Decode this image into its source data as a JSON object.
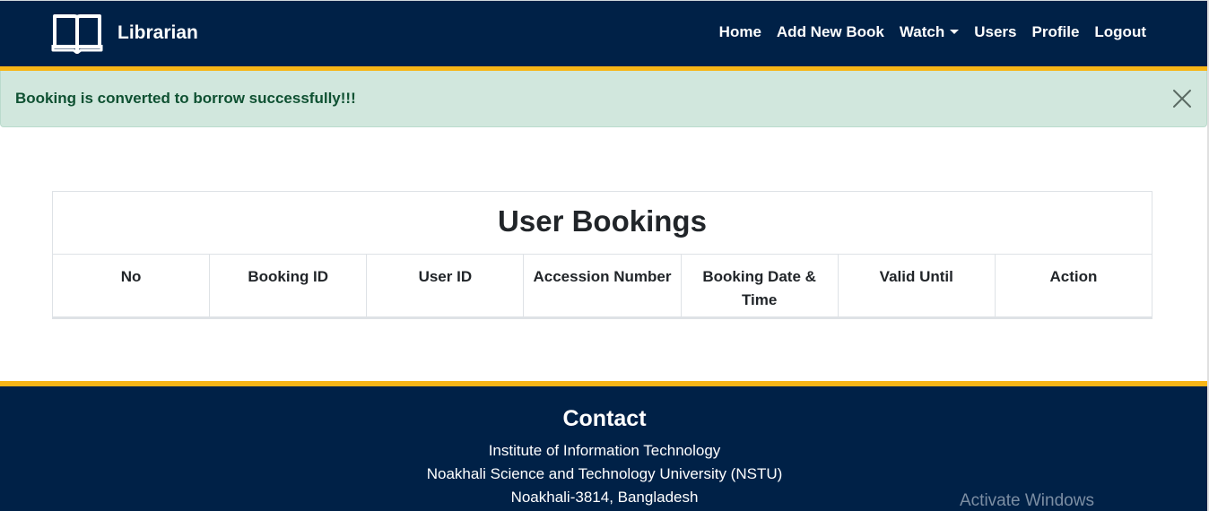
{
  "navbar": {
    "brand": "Librarian",
    "links": [
      "Home",
      "Add New Book",
      "Watch",
      "Users",
      "Profile",
      "Logout"
    ]
  },
  "alert": {
    "message": "Booking is converted to borrow successfully!!!"
  },
  "bookings": {
    "title": "User Bookings",
    "columns": [
      "No",
      "Booking ID",
      "User ID",
      "Accession Number",
      "Booking Date & Time",
      "Valid Until",
      "Action"
    ],
    "rows": []
  },
  "footer": {
    "title": "Contact",
    "lines": [
      "Institute of Information Technology",
      "Noakhali Science and Technology University (NSTU)",
      "Noakhali-3814, Bangladesh"
    ]
  },
  "watermark": "Activate Windows",
  "colors": {
    "navy": "#002147",
    "accent": "#f7b516",
    "alert_bg": "#d1e7dd",
    "alert_text": "#0f5132"
  }
}
